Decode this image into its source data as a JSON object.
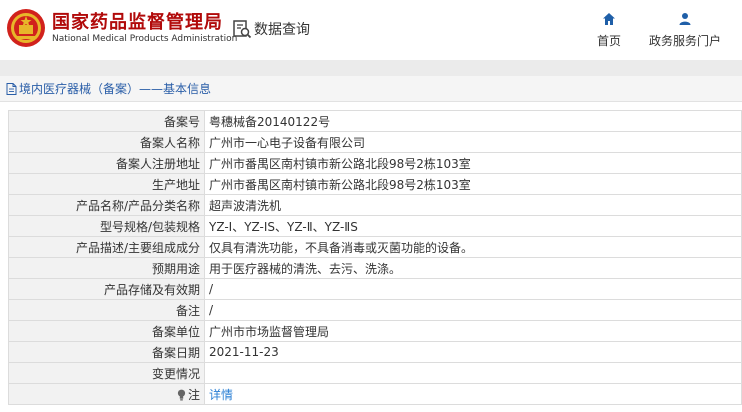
{
  "header": {
    "brand_cn": "国家药品监督管理局",
    "brand_en": "National Medical Products Administration",
    "query_label": "数据查询",
    "nav": [
      {
        "label": "首页",
        "icon": "home-icon"
      },
      {
        "label": "政务服务门户",
        "icon": "user-icon"
      }
    ]
  },
  "crumb": {
    "title": "境内医疗器械（备案）——基本信息",
    "icon": "document-icon"
  },
  "records": [
    {
      "label": "备案号",
      "value": "粤穗械备20140122号"
    },
    {
      "label": "备案人名称",
      "value": "广州市一心电子设备有限公司"
    },
    {
      "label": "备案人注册地址",
      "value": "广州市番禺区南村镇市新公路北段98号2栋103室"
    },
    {
      "label": "生产地址",
      "value": "广州市番禺区南村镇市新公路北段98号2栋103室"
    },
    {
      "label": "产品名称/产品分类名称",
      "value": "超声波清洗机"
    },
    {
      "label": "型号规格/包装规格",
      "value": "YZ-Ⅰ、YZ-ⅠS、YZ-Ⅱ、YZ-ⅡS"
    },
    {
      "label": "产品描述/主要组成成分",
      "value": "仅具有清洗功能，不具备消毒或灭菌功能的设备。"
    },
    {
      "label": "预期用途",
      "value": "用于医疗器械的清洗、去污、洗涤。"
    },
    {
      "label": "产品存储及有效期",
      "value": "/"
    },
    {
      "label": "备注",
      "value": "/"
    },
    {
      "label": "备案单位",
      "value": "广州市市场监督管理局"
    },
    {
      "label": "备案日期",
      "value": "2021-11-23"
    },
    {
      "label": "变更情况",
      "value": ""
    },
    {
      "label": "注",
      "value": "详情",
      "icon": "lightbulb-icon"
    }
  ],
  "colors": {
    "brand_red": "#b10a0a",
    "link_blue": "#2a7fd4",
    "nav_blue": "#1f5fa8",
    "label_bg": "#f2f2f2"
  }
}
